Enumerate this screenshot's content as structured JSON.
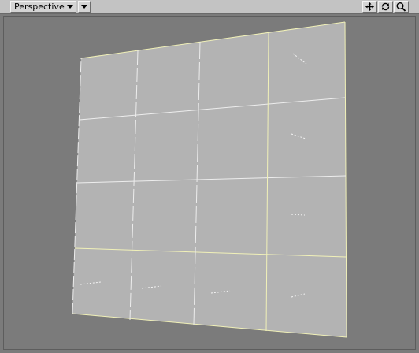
{
  "toolbar": {
    "view_mode": "Perspective",
    "icons": [
      "move-icon",
      "rotate-icon",
      "zoom-icon"
    ]
  },
  "colors": {
    "background": "#7b7b7b",
    "mesh_fill": "#b3b3b3",
    "wire": "#ededed",
    "selected_wire": "#f1f1b8"
  }
}
